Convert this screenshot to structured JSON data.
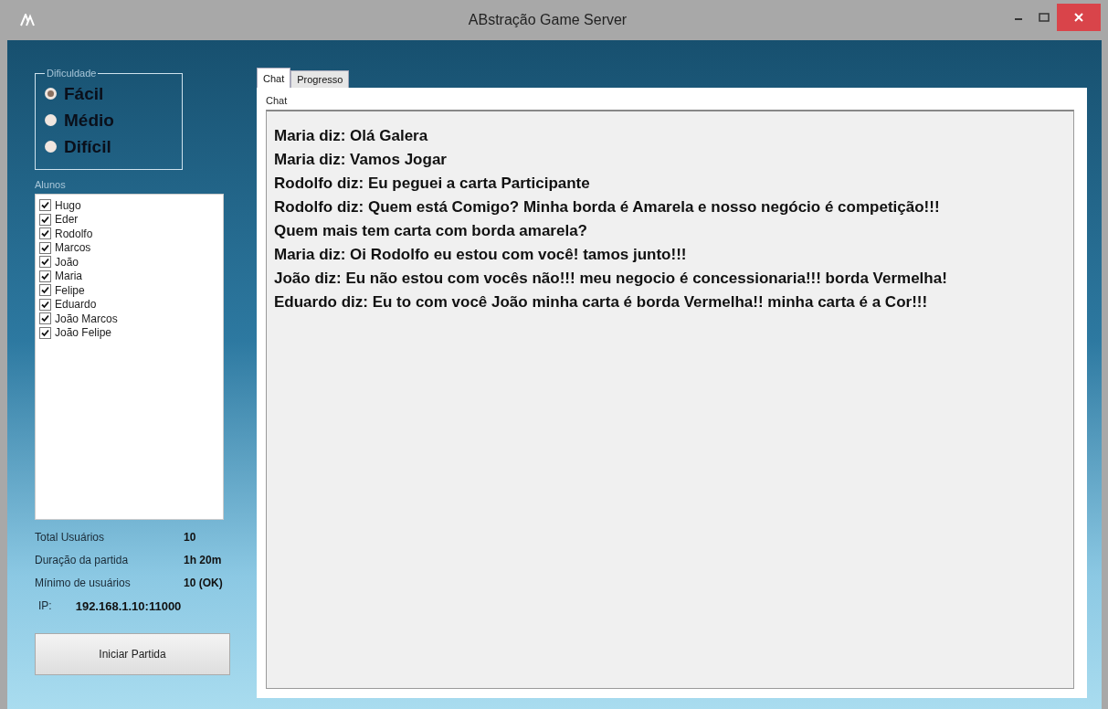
{
  "window": {
    "title": "ABstração Game Server"
  },
  "difficulty": {
    "label": "Dificuldade",
    "options": [
      {
        "label": "Fácil",
        "selected": true
      },
      {
        "label": "Médio",
        "selected": false
      },
      {
        "label": "Difícil",
        "selected": false
      }
    ]
  },
  "students": {
    "label": "Alunos",
    "items": [
      {
        "name": "Hugo",
        "checked": true
      },
      {
        "name": "Eder",
        "checked": true
      },
      {
        "name": "Rodolfo",
        "checked": true
      },
      {
        "name": "Marcos",
        "checked": true
      },
      {
        "name": "João",
        "checked": true
      },
      {
        "name": "Maria",
        "checked": true
      },
      {
        "name": "Felipe",
        "checked": true
      },
      {
        "name": "Eduardo",
        "checked": true
      },
      {
        "name": "João Marcos",
        "checked": true
      },
      {
        "name": "João Felipe",
        "checked": true
      }
    ]
  },
  "stats": [
    {
      "label": "Total Usuários",
      "value": "10"
    },
    {
      "label": "Duração da partida",
      "value": "1h 20m"
    },
    {
      "label": "Mínimo de usuários",
      "value": "10 (OK)"
    }
  ],
  "ip": {
    "label": "IP:",
    "value": "192.168.1.10:11000"
  },
  "start_button": "Iniciar Partida",
  "tabs": [
    {
      "label": "Chat",
      "selected": true
    },
    {
      "label": "Progresso",
      "selected": false
    }
  ],
  "chat": {
    "label": "Chat",
    "messages": [
      "Maria diz: Olá Galera",
      "Maria diz: Vamos Jogar",
      "Rodolfo diz: Eu peguei a carta Participante",
      "Rodolfo diz: Quem está Comigo? Minha borda é Amarela e nosso negócio é competição!!!",
      "Quem mais tem carta com borda amarela?",
      "Maria diz: Oi Rodolfo eu estou com você! tamos junto!!!",
      "João diz: Eu não estou com vocês não!!! meu negocio é concessionaria!!! borda Vermelha!",
      "Eduardo diz: Eu to com você João minha carta é borda Vermelha!! minha carta é a Cor!!!"
    ]
  }
}
